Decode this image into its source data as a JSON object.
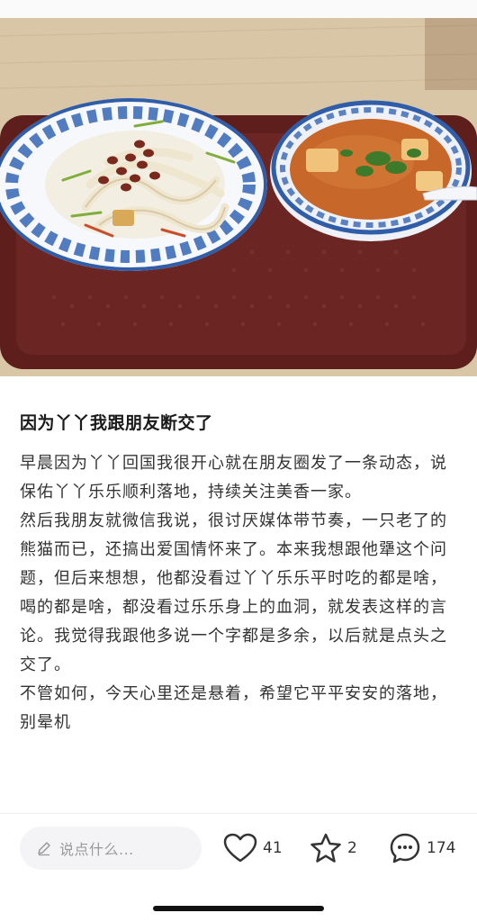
{
  "post": {
    "title": "因为丫丫我跟朋友断交了",
    "paragraphs": [
      "早晨因为丫丫回国我很开心就在朋友圈发了一条动态，说保佑丫丫乐乐顺利落地，持续关注美香一家。",
      "然后我朋友就微信我说，很讨厌媒体带节奏，一只老了的熊猫而已，还搞出爱国情怀来了。本来我想跟他犟这个问题，但后来想想，他都没看过丫丫乐乐平时吃的都是啥，喝的都是啥，都没看过乐乐身上的血洞，就发表这样的言论。我觉得我跟他多说一个字都是多余，以后就是点头之交了。",
      "不管如何，今天心里还是悬着，希望它平平安安的落地，别晕机"
    ]
  },
  "bottom_bar": {
    "comment_placeholder": "说点什么...",
    "likes": "41",
    "favorites": "2",
    "comments": "174",
    "accent": "#333333"
  },
  "icons": {
    "pen": "pencil-icon",
    "like": "heart-icon",
    "favorite": "star-icon",
    "comment": "chat-bubble-icon"
  }
}
